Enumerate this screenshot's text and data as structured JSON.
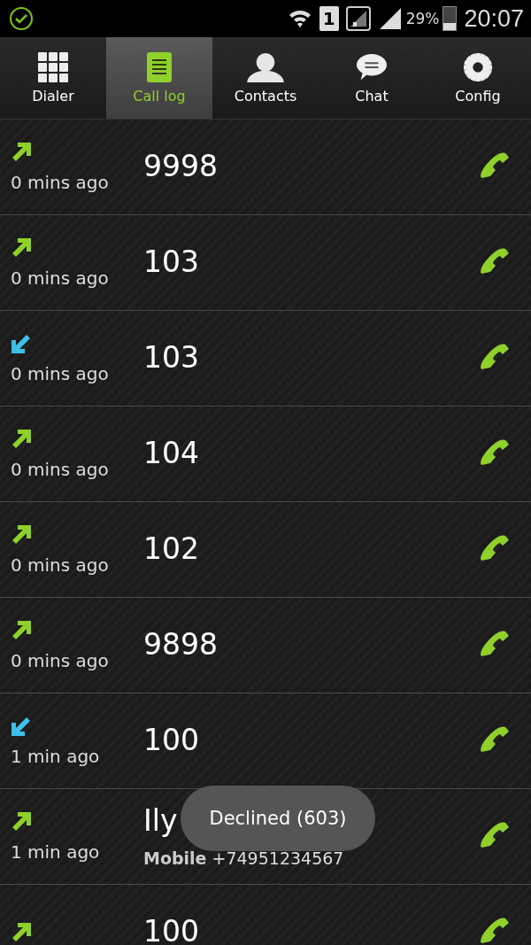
{
  "status_bar": {
    "sim_slot": "1",
    "battery": "29%",
    "time": "20:07"
  },
  "tabs": [
    {
      "label": "Dialer",
      "kind": "grid",
      "selected": false
    },
    {
      "label": "Call log",
      "kind": "list",
      "selected": true
    },
    {
      "label": "Contacts",
      "kind": "person",
      "selected": false
    },
    {
      "label": "Chat",
      "kind": "chat",
      "selected": false
    },
    {
      "label": "Config",
      "kind": "gear",
      "selected": false
    }
  ],
  "calls": [
    {
      "kind": "outgoing",
      "number": "9998",
      "time": "0 mins ago"
    },
    {
      "kind": "outgoing",
      "number": "103",
      "time": "0 mins ago"
    },
    {
      "kind": "incoming",
      "number": "103",
      "time": "0 mins ago"
    },
    {
      "kind": "outgoing",
      "number": "104",
      "time": "0 mins ago"
    },
    {
      "kind": "outgoing",
      "number": "102",
      "time": "0 mins ago"
    },
    {
      "kind": "outgoing",
      "number": "9898",
      "time": "0 mins ago"
    },
    {
      "kind": "incoming",
      "number": "100",
      "time": "1 min ago"
    },
    {
      "kind": "outgoing",
      "number": "Ily",
      "time": "1 min ago",
      "phone_type": "Mobile",
      "phone": "+74951234567"
    },
    {
      "kind": "outgoing",
      "number": "100"
    }
  ],
  "toast": "Declined (603)"
}
